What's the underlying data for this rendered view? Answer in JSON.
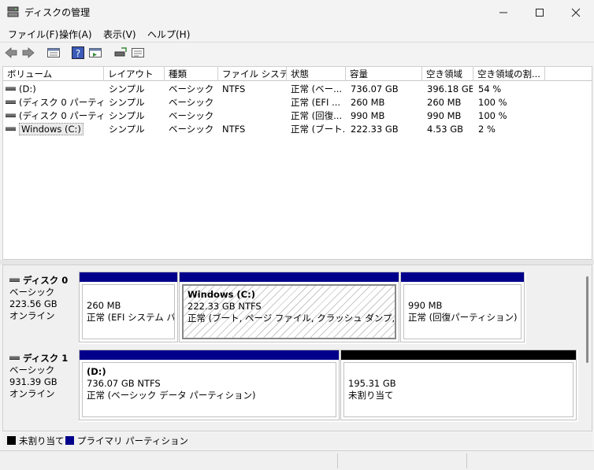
{
  "window": {
    "title": "ディスクの管理"
  },
  "menu": [
    {
      "label": "ファイル(F)"
    },
    {
      "label": "操作(A)"
    },
    {
      "label": "表示(V)"
    },
    {
      "label": "ヘルプ(H)"
    }
  ],
  "columns": [
    "ボリューム",
    "レイアウト",
    "種類",
    "ファイル システム",
    "状態",
    "容量",
    "空き領域",
    "空き領域の割..."
  ],
  "volumes": [
    {
      "name": "(D:)",
      "layout": "シンプル",
      "type": "ベーシック",
      "fs": "NTFS",
      "status": "正常 (ベー...",
      "capacity": "736.07 GB",
      "free": "396.18 GB",
      "pct": "54 %"
    },
    {
      "name": "(ディスク 0 パーティシ...",
      "layout": "シンプル",
      "type": "ベーシック",
      "fs": "",
      "status": "正常 (EFI ...",
      "capacity": "260 MB",
      "free": "260 MB",
      "pct": "100 %"
    },
    {
      "name": "(ディスク 0 パーティシ...",
      "layout": "シンプル",
      "type": "ベーシック",
      "fs": "",
      "status": "正常 (回復...",
      "capacity": "990 MB",
      "free": "990 MB",
      "pct": "100 %"
    },
    {
      "name": "Windows (C:)",
      "layout": "シンプル",
      "type": "ベーシック",
      "fs": "NTFS",
      "status": "正常 (ブート...",
      "capacity": "222.33 GB",
      "free": "4.53 GB",
      "pct": "2 %"
    }
  ],
  "disks": [
    {
      "title": "ディスク 0",
      "type": "ベーシック",
      "size": "223.56 GB",
      "state": "オンライン",
      "partitions": [
        {
          "name": "",
          "line1": "260 MB",
          "line2": "正常 (EFI システム パーティション)",
          "bar": "#00008b"
        },
        {
          "name": "Windows  (C:)",
          "line1": "222.33 GB NTFS",
          "line2": "正常 (ブート, ページ ファイル, クラッシュ ダンプ, ベーシック データ パーティション)",
          "bar": "#00008b"
        },
        {
          "name": "",
          "line1": "990 MB",
          "line2": "正常 (回復パーティション)",
          "bar": "#00008b"
        }
      ]
    },
    {
      "title": "ディスク 1",
      "type": "ベーシック",
      "size": "931.39 GB",
      "state": "オンライン",
      "partitions": [
        {
          "name": "(D:)",
          "line1": "736.07 GB NTFS",
          "line2": "正常 (ベーシック データ パーティション)",
          "bar": "#00008b"
        },
        {
          "name": "",
          "line1": "195.31 GB",
          "line2": "未割り当て",
          "bar": "#000000"
        }
      ]
    }
  ],
  "legend": [
    {
      "label": "未割り当て",
      "color": "#000000"
    },
    {
      "label": "プライマリ パーティション",
      "color": "#00008b"
    }
  ]
}
